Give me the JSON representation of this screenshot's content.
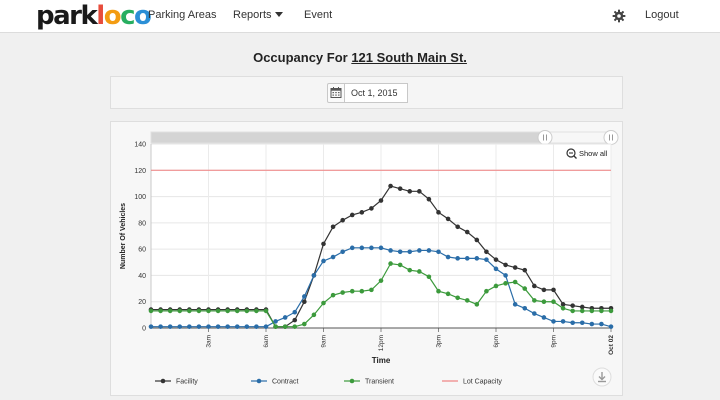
{
  "nav": {
    "logo_parts": [
      "park",
      "l",
      "o",
      "c",
      "o"
    ],
    "items": [
      "Parking Areas",
      "Reports",
      "Event"
    ],
    "logout": "Logout"
  },
  "page": {
    "title_prefix": "Occupancy For ",
    "lot_name": "121 South Main St."
  },
  "date_picker": {
    "value": "Oct 1, 2015"
  },
  "chart_data": {
    "type": "line",
    "ylabel": "Number Of Vehicles",
    "xlabel": "Time",
    "ylim": [
      0,
      140
    ],
    "yticks": [
      0,
      20,
      40,
      60,
      80,
      100,
      120,
      140
    ],
    "xlim": [
      0,
      24
    ],
    "xticks": [
      {
        "hour": 3,
        "label": "3am"
      },
      {
        "hour": 6,
        "label": "6am"
      },
      {
        "hour": 9,
        "label": "9am"
      },
      {
        "hour": 12,
        "label": "12pm"
      },
      {
        "hour": 15,
        "label": "3pm"
      },
      {
        "hour": 18,
        "label": "6pm"
      },
      {
        "hour": 21,
        "label": "9pm"
      },
      {
        "hour": 24,
        "label": "Oct 02"
      }
    ],
    "lot_capacity": 120,
    "show_all_label": "Show all",
    "legend": [
      {
        "name": "Facility",
        "color": "#333333",
        "kind": "dot"
      },
      {
        "name": "Contract",
        "color": "#2a6da8",
        "kind": "dot"
      },
      {
        "name": "Transient",
        "color": "#3c9a3c",
        "kind": "dot"
      },
      {
        "name": "Lot Capacity",
        "color": "#f08080",
        "kind": "line"
      }
    ],
    "x_hours": [
      0,
      0.5,
      1,
      1.5,
      2,
      2.5,
      3,
      3.5,
      4,
      4.5,
      5,
      5.5,
      6,
      6.5,
      7,
      7.5,
      8,
      8.5,
      9,
      9.5,
      10,
      10.5,
      11,
      11.5,
      12,
      12.5,
      13,
      13.5,
      14,
      14.5,
      15,
      15.5,
      16,
      16.5,
      17,
      17.5,
      18,
      18.5,
      19,
      19.5,
      20,
      20.5,
      21,
      21.5,
      22,
      22.5,
      23,
      23.5,
      24
    ],
    "series": [
      {
        "name": "Facility",
        "color": "#333333",
        "values": [
          14,
          14,
          14,
          14,
          14,
          14,
          14,
          14,
          14,
          14,
          14,
          14,
          14,
          1,
          1,
          6,
          20,
          40,
          64,
          77,
          82,
          86,
          88,
          91,
          97,
          108,
          106,
          104,
          104,
          98,
          88,
          83,
          77,
          73,
          67,
          58,
          52,
          48,
          46,
          44,
          32,
          29,
          29,
          18,
          17,
          16,
          15,
          15,
          15
        ]
      },
      {
        "name": "Contract",
        "color": "#2a6da8",
        "values": [
          1,
          1,
          1,
          1,
          1,
          1,
          1,
          1,
          1,
          1,
          1,
          1,
          1,
          5,
          8,
          12,
          24,
          40,
          51,
          54,
          58,
          61,
          61,
          61,
          61,
          59,
          58,
          58,
          59,
          59,
          58,
          54,
          53,
          53,
          53,
          52,
          45,
          40,
          18,
          15,
          11,
          8,
          5,
          5,
          4,
          4,
          3,
          3,
          1
        ]
      },
      {
        "name": "Transient",
        "color": "#3c9a3c",
        "values": [
          13,
          13,
          13,
          13,
          13,
          13,
          13,
          13,
          13,
          13,
          13,
          13,
          13,
          1,
          1,
          1,
          3,
          10,
          19,
          25,
          27,
          28,
          28,
          29,
          36,
          49,
          48,
          44,
          43,
          39,
          28,
          26,
          23,
          21,
          18,
          28,
          32,
          34,
          35,
          30,
          21,
          20,
          20,
          15,
          13,
          13,
          13,
          13,
          13
        ]
      }
    ]
  }
}
